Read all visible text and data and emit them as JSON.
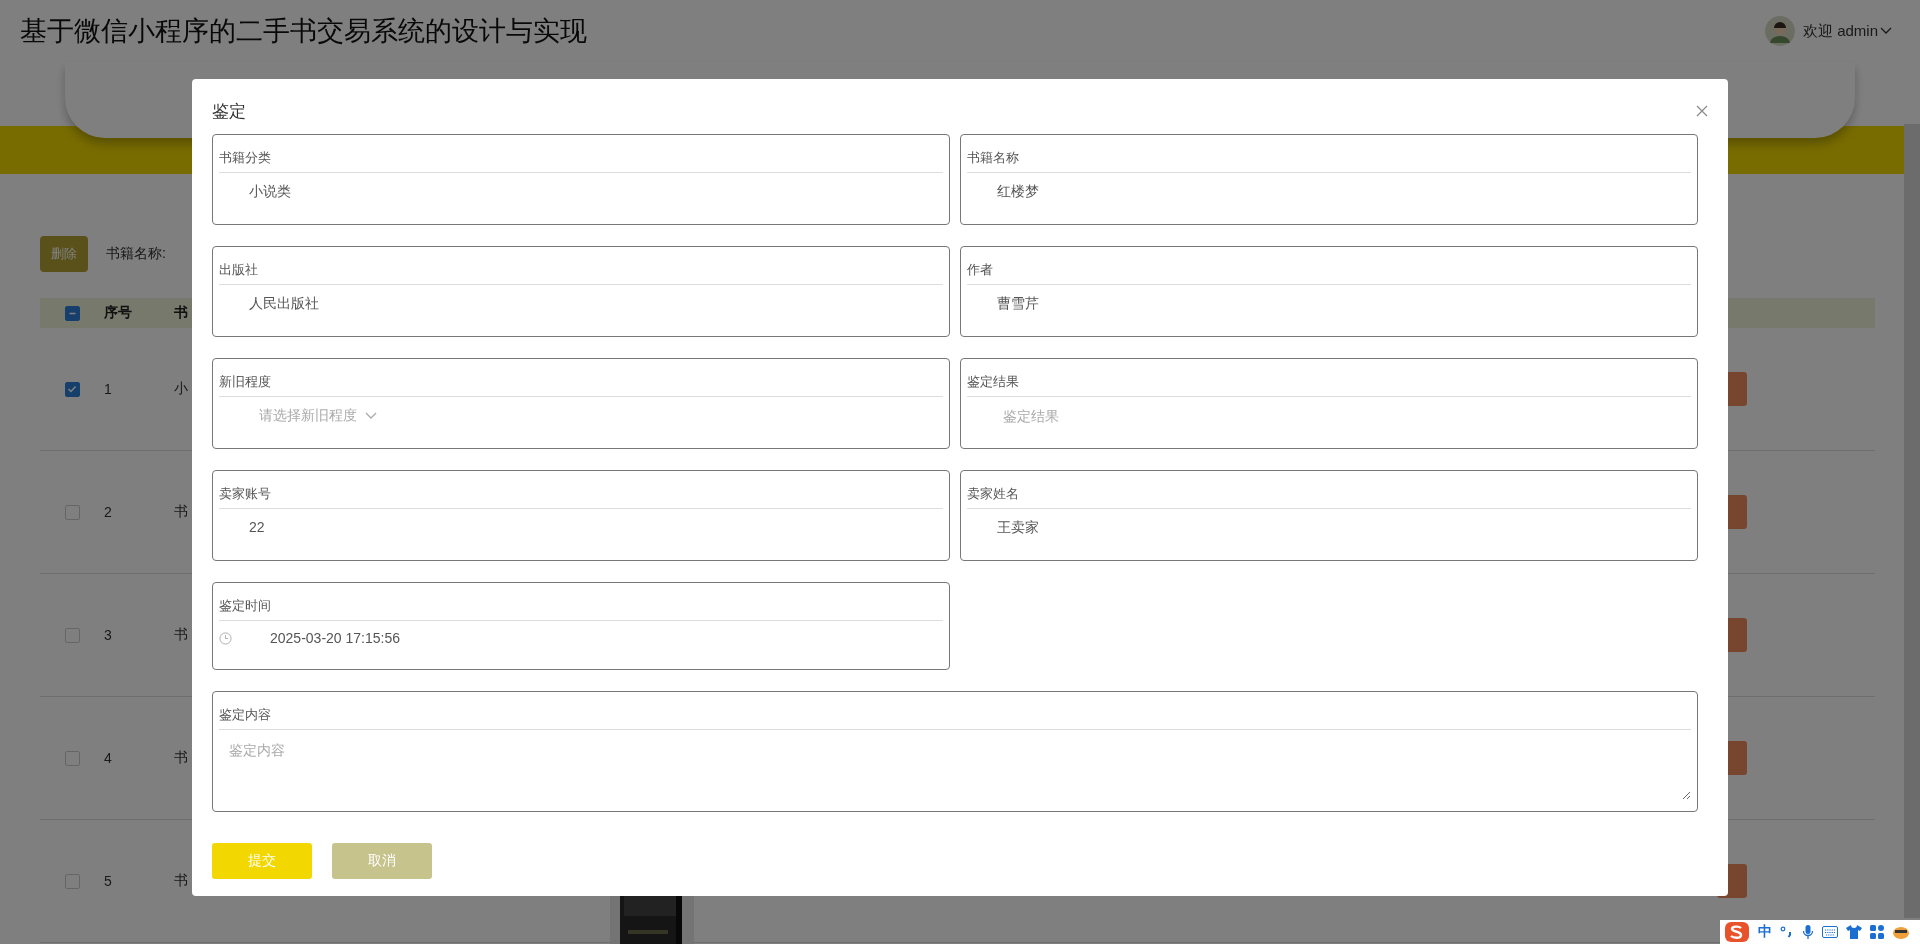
{
  "header": {
    "title": "基于微信小程序的二手书交易系统的设计与实现",
    "welcome": "欢迎 admin"
  },
  "toolbar": {
    "delete_button": "删除",
    "search_label": "书籍名称:"
  },
  "table": {
    "header_checkbox": {
      "indeterminate": true
    },
    "columns": [
      "序号",
      "书"
    ],
    "rows": [
      {
        "index": "1",
        "column_3": "小",
        "selected": true
      },
      {
        "index": "2",
        "column_3": "书",
        "selected": false
      },
      {
        "index": "3",
        "column_3": "书",
        "selected": false
      },
      {
        "index": "4",
        "column_3": "书",
        "selected": false
      },
      {
        "index": "5",
        "column_3": "书",
        "selected": false
      }
    ]
  },
  "dialog": {
    "title": "鉴定",
    "fields": [
      {
        "kind": "text",
        "label": "书籍分类",
        "value": "小说类"
      },
      {
        "kind": "text",
        "label": "书籍名称",
        "value": "红楼梦"
      },
      {
        "kind": "text",
        "label": "出版社",
        "value": "人民出版社"
      },
      {
        "kind": "text",
        "label": "作者",
        "value": "曹雪芹"
      },
      {
        "kind": "select",
        "label": "新旧程度",
        "placeholder": "请选择新旧程度"
      },
      {
        "kind": "input",
        "label": "鉴定结果",
        "placeholder": "鉴定结果"
      },
      {
        "kind": "text",
        "label": "卖家账号",
        "value": "22"
      },
      {
        "kind": "text",
        "label": "卖家姓名",
        "value": "王卖家"
      },
      {
        "kind": "datetime",
        "label": "鉴定时间",
        "value": "2025-03-20 17:15:56"
      },
      {
        "kind": "textarea",
        "label": "鉴定内容",
        "placeholder": "鉴定内容"
      }
    ],
    "buttons": [
      {
        "kind": "primary",
        "label": "提交"
      },
      {
        "kind": "secondary",
        "label": "取消"
      }
    ]
  },
  "ime": {
    "mode": "中"
  }
}
